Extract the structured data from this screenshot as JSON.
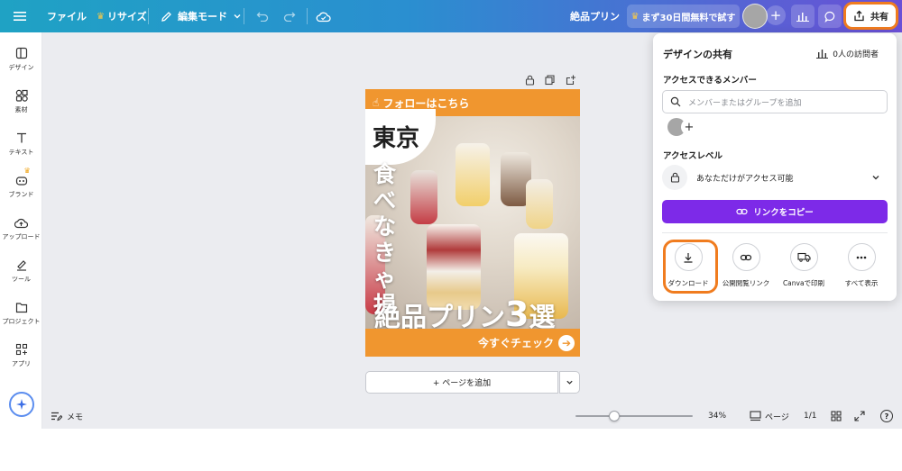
{
  "topbar": {
    "file": "ファイル",
    "resize": "リサイズ",
    "edit_mode": "編集モード",
    "design_title": "絶品プリン",
    "trial": "まず30日間無料で試す",
    "share": "共有",
    "icons": [
      "menu-icon",
      "crown-icon",
      "pencil-icon",
      "chevron-down-icon",
      "undo-icon",
      "redo-icon",
      "cloud-sync-icon",
      "avatar",
      "plus-icon",
      "bar-chart-icon",
      "comment-icon",
      "share-icon"
    ],
    "colors": {
      "gradient_start": "#1fa2c4",
      "gradient_end": "#6b4fd6",
      "highlight": "#f07c1f"
    }
  },
  "sidebar": {
    "items": [
      {
        "label": "デザイン",
        "icon": "layout-icon"
      },
      {
        "label": "素材",
        "icon": "shapes-icon"
      },
      {
        "label": "テキスト",
        "icon": "text-icon"
      },
      {
        "label": "ブランド",
        "icon": "brand-icon"
      },
      {
        "label": "アップロード",
        "icon": "upload-icon"
      },
      {
        "label": "ツール",
        "icon": "draw-icon"
      },
      {
        "label": "プロジェクト",
        "icon": "folder-icon"
      },
      {
        "label": "アプリ",
        "icon": "apps-icon"
      }
    ],
    "magic_icon": "sparkle-icon"
  },
  "design": {
    "follow": "フォローはこちら",
    "city": "東京",
    "vertical_text": "食べなきゃ損",
    "headline_prefix": "絶品プリン",
    "headline_num": "3",
    "headline_suffix": "選",
    "cta": "今すぐチェック",
    "colors": {
      "accent": "#f0962f"
    }
  },
  "canvas": {
    "add_page": "+ ページを追加"
  },
  "bottombar": {
    "notes": "メモ",
    "zoom": "34%",
    "zoom_level": 0.34,
    "pages": "ページ",
    "page_count": "1/1",
    "help": "?"
  },
  "share_panel": {
    "title": "デザインの共有",
    "visitors": "0人の訪問者",
    "members_label": "アクセスできるメンバー",
    "search_placeholder": "メンバーまたはグループを追加",
    "access_label": "アクセスレベル",
    "access_value": "あなただけがアクセス可能",
    "copy_link": "リンクをコピー",
    "options": [
      {
        "label": "ダウンロード",
        "icon": "download-icon"
      },
      {
        "label": "公開閲覧リンク",
        "icon": "link-icon"
      },
      {
        "label": "Canvaで印刷",
        "icon": "truck-icon"
      },
      {
        "label": "すべて表示",
        "icon": "more-icon"
      }
    ],
    "colors": {
      "primary": "#7d2ae8"
    }
  }
}
